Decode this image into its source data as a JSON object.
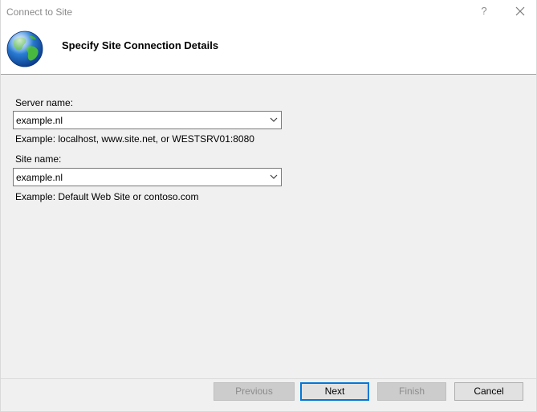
{
  "window": {
    "title": "Connect to Site",
    "help_glyph": "?",
    "close_icon": "close-icon"
  },
  "header": {
    "title": "Specify Site Connection Details",
    "icon": "globe-icon"
  },
  "server": {
    "label": "Server name:",
    "value": "example.nl",
    "example": "Example: localhost, www.site.net, or WESTSRV01:8080"
  },
  "site": {
    "label": "Site name:",
    "value": "example.nl",
    "example": "Example: Default Web Site or contoso.com"
  },
  "buttons": {
    "previous": "Previous",
    "next": "Next",
    "finish": "Finish",
    "cancel": "Cancel"
  },
  "colors": {
    "accent": "#0078d7",
    "dialog_bg": "#f0f0f0"
  }
}
